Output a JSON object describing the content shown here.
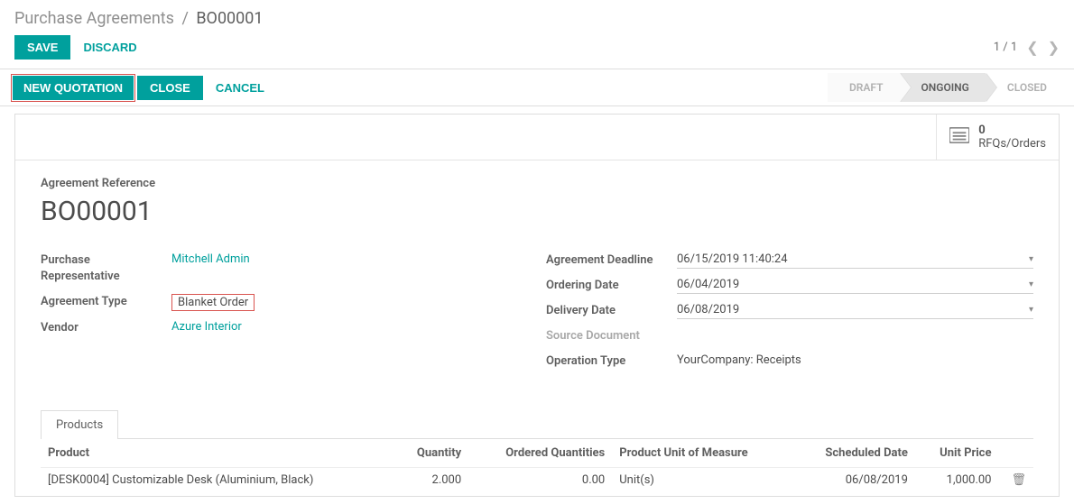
{
  "breadcrumb": {
    "parent": "Purchase Agreements",
    "current": "BO00001"
  },
  "actions": {
    "save": "SAVE",
    "discard": "DISCARD",
    "new_quotation": "NEW QUOTATION",
    "close": "CLOSE",
    "cancel": "CANCEL"
  },
  "pager": {
    "text": "1 / 1"
  },
  "statusbar": {
    "draft": "DRAFT",
    "ongoing": "ONGOING",
    "closed": "CLOSED"
  },
  "stat": {
    "count": "0",
    "label": "RFQs/Orders"
  },
  "form": {
    "agreement_reference_label": "Agreement Reference",
    "agreement_reference": "BO00001",
    "left": {
      "purchase_rep_label": "Purchase Representative",
      "purchase_rep": "Mitchell Admin",
      "agreement_type_label": "Agreement Type",
      "agreement_type": "Blanket Order",
      "vendor_label": "Vendor",
      "vendor": "Azure Interior"
    },
    "right": {
      "deadline_label": "Agreement Deadline",
      "deadline": "06/15/2019 11:40:24",
      "ordering_label": "Ordering Date",
      "ordering": "06/04/2019",
      "delivery_label": "Delivery Date",
      "delivery": "06/08/2019",
      "source_doc_label": "Source Document",
      "operation_type_label": "Operation Type",
      "operation_type": "YourCompany: Receipts"
    }
  },
  "tabs": {
    "products": "Products"
  },
  "table": {
    "headers": {
      "product": "Product",
      "quantity": "Quantity",
      "ordered": "Ordered Quantities",
      "uom": "Product Unit of Measure",
      "scheduled": "Scheduled Date",
      "price": "Unit Price"
    },
    "rows": [
      {
        "product": "[DESK0004] Customizable Desk (Aluminium, Black)",
        "quantity": "2.000",
        "ordered": "0.00",
        "uom": "Unit(s)",
        "scheduled": "06/08/2019",
        "price": "1,000.00"
      }
    ]
  }
}
